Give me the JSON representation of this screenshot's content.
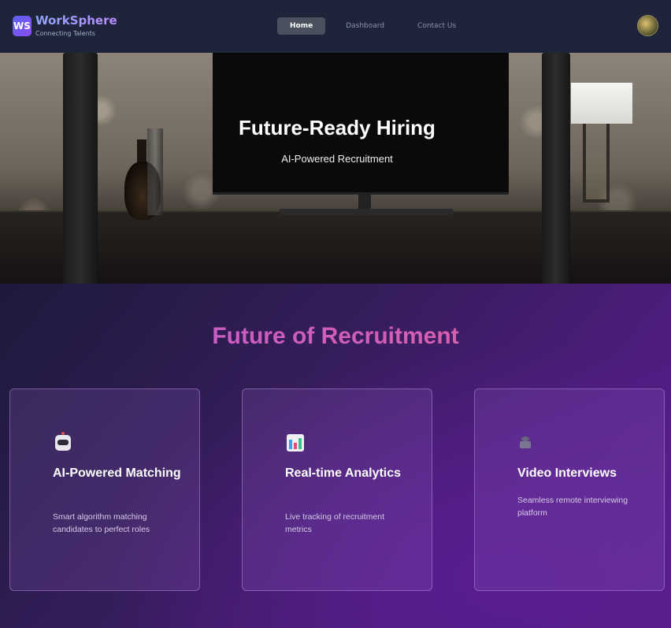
{
  "brand": {
    "logo_text": "WS",
    "name": "WorkSphere",
    "tagline": "Connecting Talents"
  },
  "nav": {
    "items": [
      {
        "label": "Home",
        "active": true
      },
      {
        "label": "Dashboard",
        "active": false
      },
      {
        "label": "Contact Us",
        "active": false
      }
    ]
  },
  "hero": {
    "title": "Future-Ready Hiring",
    "subtitle": "AI-Powered Recruitment"
  },
  "features": {
    "title": "Future of Recruitment",
    "cards": [
      {
        "icon": "robot-icon",
        "title": "AI-Powered Matching",
        "description": "Smart algorithm matching candidates to perfect roles"
      },
      {
        "icon": "bar-chart-icon",
        "title": "Real-time Analytics",
        "description": "Live tracking of recruitment metrics"
      },
      {
        "icon": "video-camera-icon",
        "title": "Video Interviews",
        "description": "Seamless remote interviewing platform"
      }
    ]
  },
  "colors": {
    "accent": "#8a4df0",
    "section_title_start": "#c05cd8",
    "section_title_end": "#e0609a",
    "nav_bg": "#1e263a"
  }
}
